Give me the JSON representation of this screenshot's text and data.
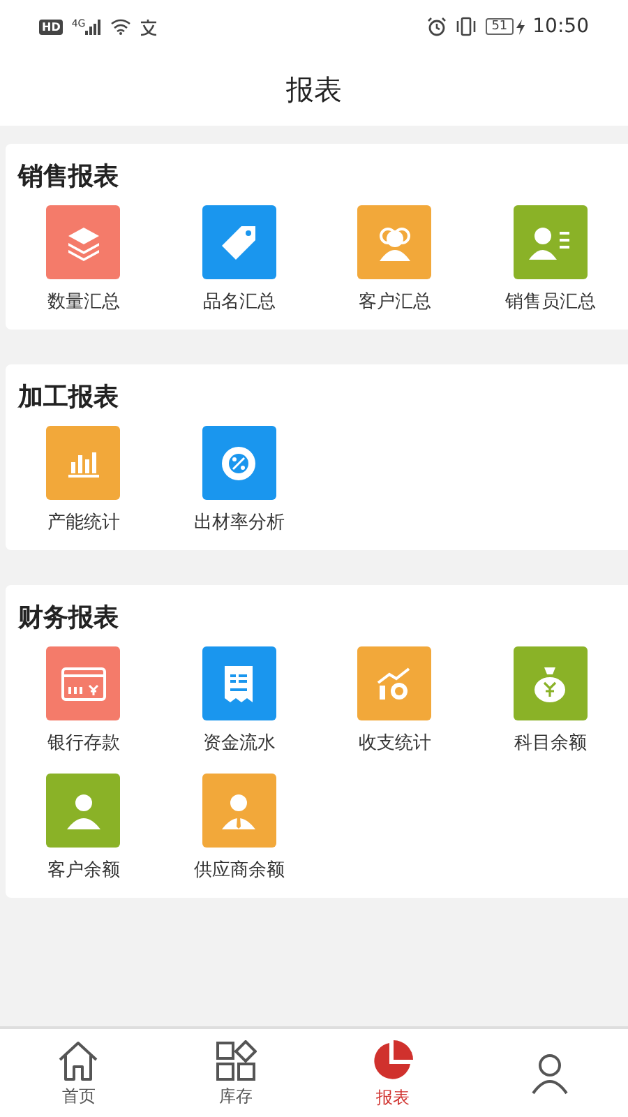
{
  "status_bar": {
    "network_badge": "HD",
    "network_type": "4G",
    "battery": "51",
    "time": "10:50"
  },
  "header": {
    "title": "报表"
  },
  "sections": [
    {
      "title": "销售报表",
      "items": [
        {
          "label": "数量汇总",
          "kind": "layers",
          "color": "#f47b6a"
        },
        {
          "label": "品名汇总",
          "kind": "tag",
          "color": "#1a96ee"
        },
        {
          "label": "客户汇总",
          "kind": "people",
          "color": "#f2a83a"
        },
        {
          "label": "销售员汇总",
          "kind": "salesman",
          "color": "#8ab227"
        }
      ]
    },
    {
      "title": "加工报表",
      "items": [
        {
          "label": "产能统计",
          "kind": "bars",
          "color": "#f2a83a"
        },
        {
          "label": "出材率分析",
          "kind": "percent",
          "color": "#1a96ee"
        }
      ]
    },
    {
      "title": "财务报表",
      "items": [
        {
          "label": "银行存款",
          "kind": "card",
          "color": "#f47b6a"
        },
        {
          "label": "资金流水",
          "kind": "receipt",
          "color": "#1a96ee"
        },
        {
          "label": "收支统计",
          "kind": "growth",
          "color": "#f2a83a"
        },
        {
          "label": "科目余额",
          "kind": "moneybag",
          "color": "#8ab227"
        },
        {
          "label": "客户余额",
          "kind": "person",
          "color": "#8ab227"
        },
        {
          "label": "供应商余额",
          "kind": "supplier",
          "color": "#f2a83a"
        }
      ]
    }
  ],
  "tab_bar": [
    {
      "label": "首页",
      "kind": "home",
      "selected": false
    },
    {
      "label": "库存",
      "kind": "stock",
      "selected": false
    },
    {
      "label": "报表",
      "kind": "report",
      "selected": true
    },
    {
      "kind": "profile",
      "selected": false
    }
  ]
}
